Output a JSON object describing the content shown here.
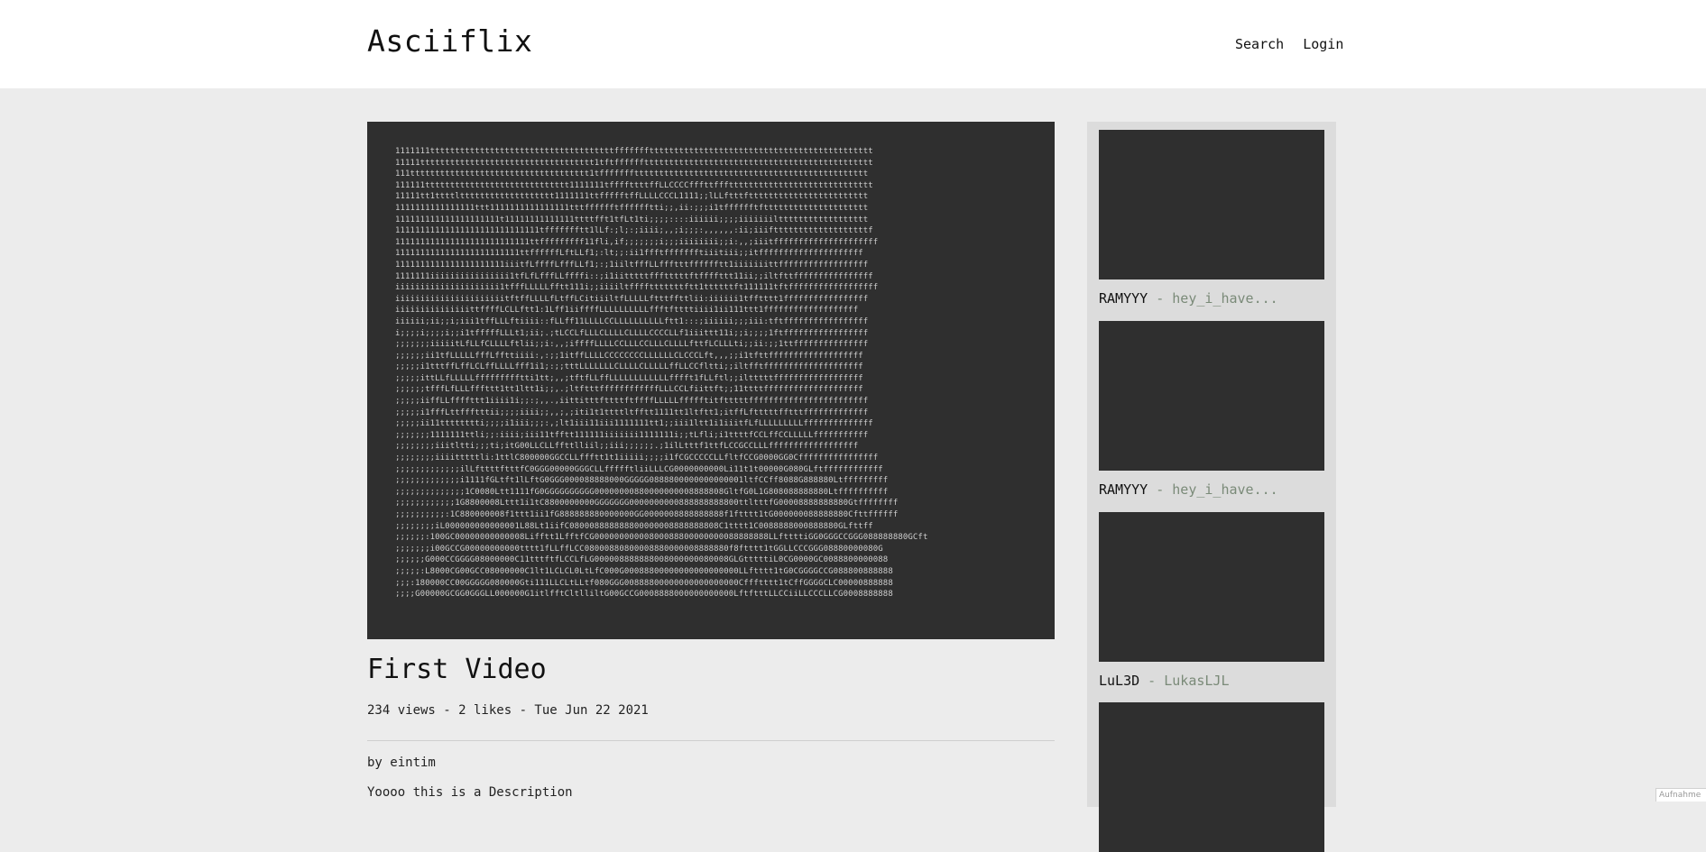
{
  "header": {
    "brand": "Asciiflix",
    "nav": [
      "Search",
      "Login"
    ]
  },
  "player": {
    "ascii_lines": [
      "1111111tttttttttttttttttttttttttttttttttttttfffffffttttttttttttttttttttttttttttttttttttttttttttt",
      "11111ttttttttttttttttttttttttttttttttttt1tftfffffftttttttttttttttttttttttttttttttttttttttttttttt",
      "111tttttttttttttttttttttttttttttttttttt1tfffffffttttttttttttttttttttttttttttttttttttttttttttttt",
      "111111ttttttttttttttttttttttttttttt1111111tffffttttffLLCCCCfffttfffttttttttttttttttttttttttttttt",
      "11111tt1ttttlttttttttttttttttttt1111111ttffffftffLLLLCCCL1111;;lLLftttftttttttttttttttttttttttt",
      "1111111111111111ttt1111111111111111tttfffffftfffffftti;;,ii:;;;i1tfffffftfttttttttttttttttttttt",
      "111111111111111111111t11111111111111ttttfft1tfLt1ti;;;;::::iiiiii;;;;iiiiiiiltttttttttttttttttt",
      "11111111111111111111111111111tffffffftt1lLf:;l;:;iiii;,,;i;;;:,,,,,,:ii;iiiftttttttttttttttttttf",
      "111111111111111111111111111ttfffffffff11fli,if;;;;;;;i;;;iiiiiiii;;i:,,;iiitfffffffffffffffffffff",
      "1111111111111111111111111ttffffffLftLLf1;:lt;;:ii1ffftffffffftiiitiii;;itfffffffffffffffffffff",
      "1111111111111111111111iiitfLffffLfffLLf1;:;1iiltfffLLffftttfffffftt1iiiiiiittffffffffffffffffff",
      "1111111iiiiiiiiiiiiiiii1tfLfLfffLLffffi::;i1iitttttffftttttftffffttt11ii;;iltfttffffffffffffffff",
      "iiiiiiiiiiiiiiiiiiiii1tfffLLLLLfftt111i;;iiiiltfffftttttttftt1ttttttft111111tftffffffffffffffffff",
      "iiiiiiiiiiiiiiiiiiiiiitftffLLLLfLtffLCitiiiltfLLLLLftttffttlii:iiiiii1tfftttt1fffffffffffffffff",
      "iiiiiiiiiiiiiiittffffLCLLftt1:1Lff1iiffffLLLLLLLLLLffftfttttiiii1ii111ttt1fffffffffffffffffff",
      "iiiiii;ii;;i;iii1tffLLLftiiii::fLLff11LLLLCCLLLLLLLLLLftt1:::;iiiiii;;;iii:tftfffffffffffffffff",
      "i;;;;i;;;;i;;i1tfffffLLLt1;ii;.;tLCCLfLLLCLLLLCLLLLCCCCLLf1iiittt11i;;i;;;;1ftfffffffffffffffff",
      ";;;;;;;iiiiitLfLLfCLLLLftlii;;i:,,;iffffLLLLCCLLLCCLLLCLLLLfttfLCLLLti;;ii:;;1ttfffffffffffffff",
      ";;;;;;ii1tfLLLLLfffLffttiiii:,:;;1itffLLLLCCCCCCCCLLLLLLCLCCCLft,,,;;i1tfttfffffffffffffffffff",
      ";;;;;i1tttffLffLCLffLLLLfff1i1;:;;tttLLLLLLLCLLLLCLLLLLffLLCCfltti;;iltfftffffffffffffffffffff",
      ";;;;;ittLLfLLLLLffffffffftti1tt;,,;tftfLLffLLLLLLLLLLLLfffft1fLLftl;;iltttttffffffffffffffffff",
      ";;;;;;tfffLfLLLfffttt1tt1ltt1i;;,.;ltftttffffffffffffLLLCCLfiittft;;11ttttffffffffffffffffffff",
      ";;;;;iiffLLffffttt1iiii1i;;:;,,.,iittitttfttttftffffLLLLLffffftitftttttffffffffffffffffffffffff",
      ";;;;;i1fffLttffftttii;;;;iiii;;,,;,;iti1t1ttttltfftt1111tt1ltftt1;itffLftttttfftttfffffffffffff",
      ";;;;;ii11tttttttti;;;;i1iii;;;:,;lt1iii11iii1111111tt1;;iii1ltt1i1iiitfLfLLLLLLLLLffffffffffffff",
      ";;;;;;;1111111ttli;;:iiii;iii11tfftt111111iiiiiii1111111i;;tLfli;i1ttttfCCLffCCLLLLLfffffffffff",
      ";;;;;;;;iiitltti;;;ti;itG00LLCLLffttlliil;;iii;;;;;;.;1ilLtttf1ttfLCCGCCLLLffffffffffffffffff",
      ";;;;;;;;iiiitttttli:1ttlC800000GGCCLLffftt1t1iiiii;;;;i1fCGCCCCCLLfltfCCG0000GG0Cffffffffffffffff",
      ";;;;;;;;;;;;;ilLfttttftttfC0GGG00000GGGCLLffffftliiLLLCG0000000000Li11t1t00000G080GLftffffffffffff",
      ";;;;;;;;;;;;;i1111fGLtft1lLftG0GGG000088888000GGGGG0888800000000000001ltfCCff8088G888880Ltfffffffff",
      ";;;;;;;;;;;;;;1C0080Ltt1111fG0GGGGGGGGGG00000000880000000008888808GltfG0L1G808088888880Ltffffffffff",
      ";;;;;;;;;;;;1G8800008Lttt1i1tC8800000000GGGGGGG0000000000888888888800ttltttfG00008888888880Gtffffffff",
      ";;;;;;;;;;:1C880000008f1ttt1ii1fG888888880000000GG0000008888888888f1ftttt1tG000000088888880Cfttffffff",
      ";;;;;;;;iL000000000000001L88Lt1iifC080008888888800000008888888808C1tttt1C0088888000888880GLfttff",
      ";;;;;;:100GC00000000000008Lifftt1LfftfCG00000000000800088800000000088888888LLfttttiGG0GGGCCGGG088888880GCft",
      ";;;;;;;i00GCCG00000000000tttt1fLLffLCC08000880800008880000008888880f8ftttt1tGGLLCCCGGG08880000080G",
      ";;;;;;G000CCGGGG08000000C11tttftfLCCLfLG000008888888008000000080008GLGtttttiL0CG0000GC0088800000088",
      ";;;;;:L8000CG00GCC08000000C1lt1LCLCL0LtLfC000G00088800000000000000000LLftttt1tG0CGGGGCCG088800888888",
      ";;;:180000CC00GGGGG080000Gti111LLCLtLLtf080GGG00888800000000000000000Cffftttt1tCffGGGGCLC00000888888",
      ";;;;G00000GCGG0GGGLL000000G1itlfftCltlliltG00GCCG0008888000000000000LftftttLLCCiiLLCCCLLCG0008888888"
    ]
  },
  "video": {
    "title": "First Video",
    "meta": "234 views - 2 likes - Tue Jun 22 2021",
    "author": "by eintim",
    "description": "Yoooo this is a Description"
  },
  "recommendations": [
    {
      "user": "RAMYYY",
      "sep": " - ",
      "title": "hey_i_have..."
    },
    {
      "user": "RAMYYY",
      "sep": " - ",
      "title": "hey_i_have..."
    },
    {
      "user": "LuL3D",
      "sep": " - ",
      "title": "LukasLJL"
    },
    {
      "user": "",
      "sep": "",
      "title": ""
    }
  ],
  "corner_widget": {
    "text": "Aufnahme"
  },
  "colors": {
    "header_bg": "#ffffff",
    "page_bg": "#ececec",
    "player_bg": "#2f2f2f",
    "sidebar_bg": "#dcdcdc",
    "muted_green": "#7a8a78"
  }
}
